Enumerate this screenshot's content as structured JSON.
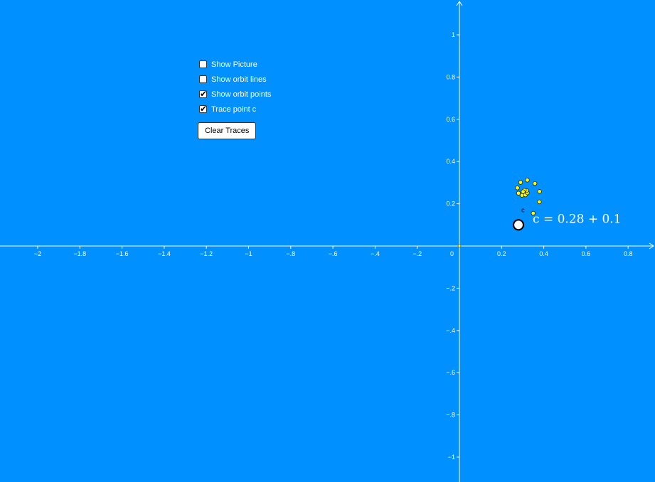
{
  "controls": {
    "checkboxes": [
      {
        "label": "Show Picture",
        "checked": false
      },
      {
        "label": "Show orbit lines",
        "checked": false
      },
      {
        "label": "Show orbit points",
        "checked": true
      },
      {
        "label": "Trace point c",
        "checked": true
      }
    ],
    "clear_button": "Clear Traces"
  },
  "axes": {
    "x_ticks": [
      -2,
      -1.8,
      -1.6,
      -1.4,
      -1.2,
      -1,
      -0.8,
      -0.6,
      -0.4,
      -0.2,
      0.2,
      0.4,
      0.6,
      0.8
    ],
    "y_ticks": [
      1,
      0.8,
      0.6,
      0.4,
      0.2,
      -0.2,
      -0.4,
      -0.6,
      -0.8,
      -1
    ],
    "origin_label": "0"
  },
  "point_c": {
    "name": "c",
    "re": 0.28,
    "im": 0.1,
    "expression": "c = 0.28 + 0.1"
  },
  "orbit_points": [
    [
      0.28,
      0.1
    ],
    [
      0.35,
      0.155
    ],
    [
      0.379,
      0.209
    ],
    [
      0.38,
      0.258
    ],
    [
      0.358,
      0.296
    ],
    [
      0.322,
      0.312
    ],
    [
      0.29,
      0.301
    ],
    [
      0.275,
      0.275
    ],
    [
      0.28,
      0.25
    ],
    [
      0.297,
      0.24
    ],
    [
      0.313,
      0.242
    ],
    [
      0.322,
      0.252
    ],
    [
      0.318,
      0.262
    ],
    [
      0.308,
      0.264
    ],
    [
      0.302,
      0.257
    ]
  ],
  "colors": {
    "background": "#0090ff",
    "orbit_point": "#ffff00",
    "axes": "#ffffff"
  }
}
